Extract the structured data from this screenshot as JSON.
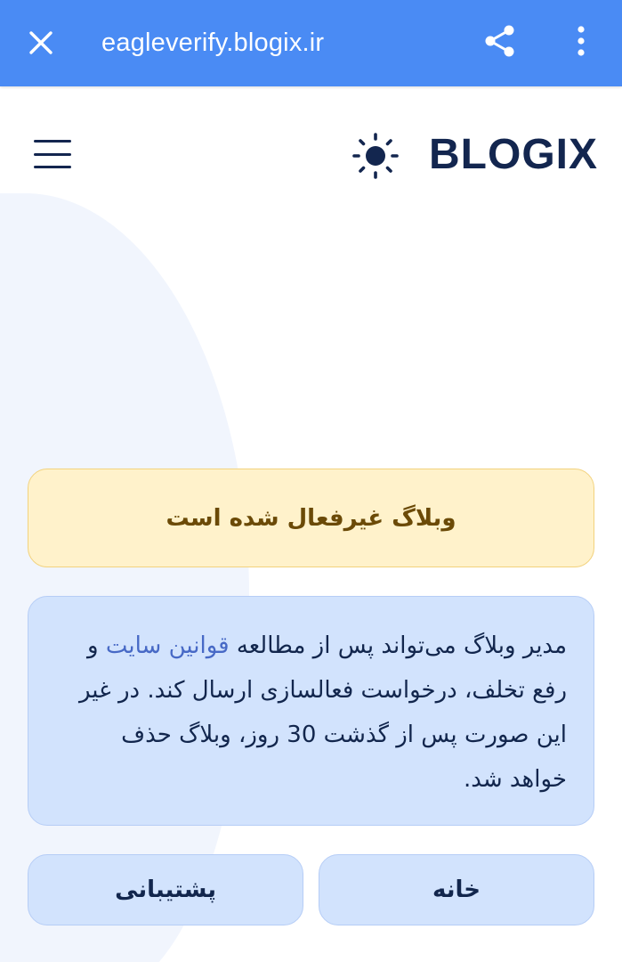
{
  "browser": {
    "url": "eagleverify.blogix.ir",
    "close_icon": "close-icon",
    "share_icon": "share-icon",
    "more_icon": "more-vert-icon",
    "bar_color": "#4a8bf4"
  },
  "header": {
    "brand": "BLOGIX",
    "theme_icon": "sun-icon",
    "menu_icon": "hamburger-menu-icon"
  },
  "notice": {
    "title": "وبلاگ غیرفعال شده است",
    "message_part1": "مدیر وبلاگ می‌تواند پس از مطالعه ",
    "message_link": "قوانین سایت",
    "message_part2": " و رفع تخلف، درخواست فعالسازی ارسال کند. در غیر این صورت پس از گذشت 30 روز، وبلاگ حذف خواهد شد."
  },
  "actions": {
    "home_label": "خانه",
    "support_label": "پشتیبانی"
  },
  "colors": {
    "warning_bg": "#fff2cb",
    "info_bg": "#d2e3fd",
    "brand_text": "#13264f",
    "link": "#4769c6"
  }
}
